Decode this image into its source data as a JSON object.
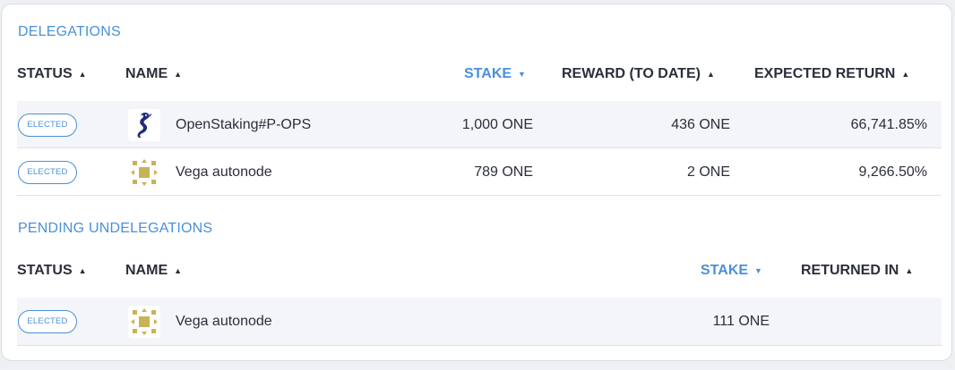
{
  "delegations": {
    "title": "DELEGATIONS",
    "headers": {
      "status": "STATUS",
      "name": "NAME",
      "stake": "STAKE",
      "reward": "REWARD (TO DATE)",
      "expected_return": "EXPECTED RETURN"
    },
    "rows": [
      {
        "status": "ELECTED",
        "name": "OpenStaking#P-OPS",
        "stake": "1,000 ONE",
        "reward": "436 ONE",
        "expected_return": "66,741.85%",
        "avatar": "seahorse-logo-icon"
      },
      {
        "status": "ELECTED",
        "name": "Vega autonode",
        "stake": "789 ONE",
        "reward": "2 ONE",
        "expected_return": "9,266.50%",
        "avatar": "vega-pattern-logo-icon"
      }
    ]
  },
  "pending_undelegations": {
    "title": "PENDING UNDELEGATIONS",
    "headers": {
      "status": "STATUS",
      "name": "NAME",
      "stake": "STAKE",
      "returned_in": "RETURNED IN"
    },
    "rows": [
      {
        "status": "ELECTED",
        "name": "Vega autonode",
        "stake": "111 ONE",
        "returned_in": "",
        "avatar": "vega-pattern-logo-icon"
      }
    ]
  },
  "colors": {
    "accent": "#4a90d9",
    "text": "#2b2f3a",
    "row_shade": "#f3f5f9",
    "vega_gold": "#c8b25a"
  }
}
